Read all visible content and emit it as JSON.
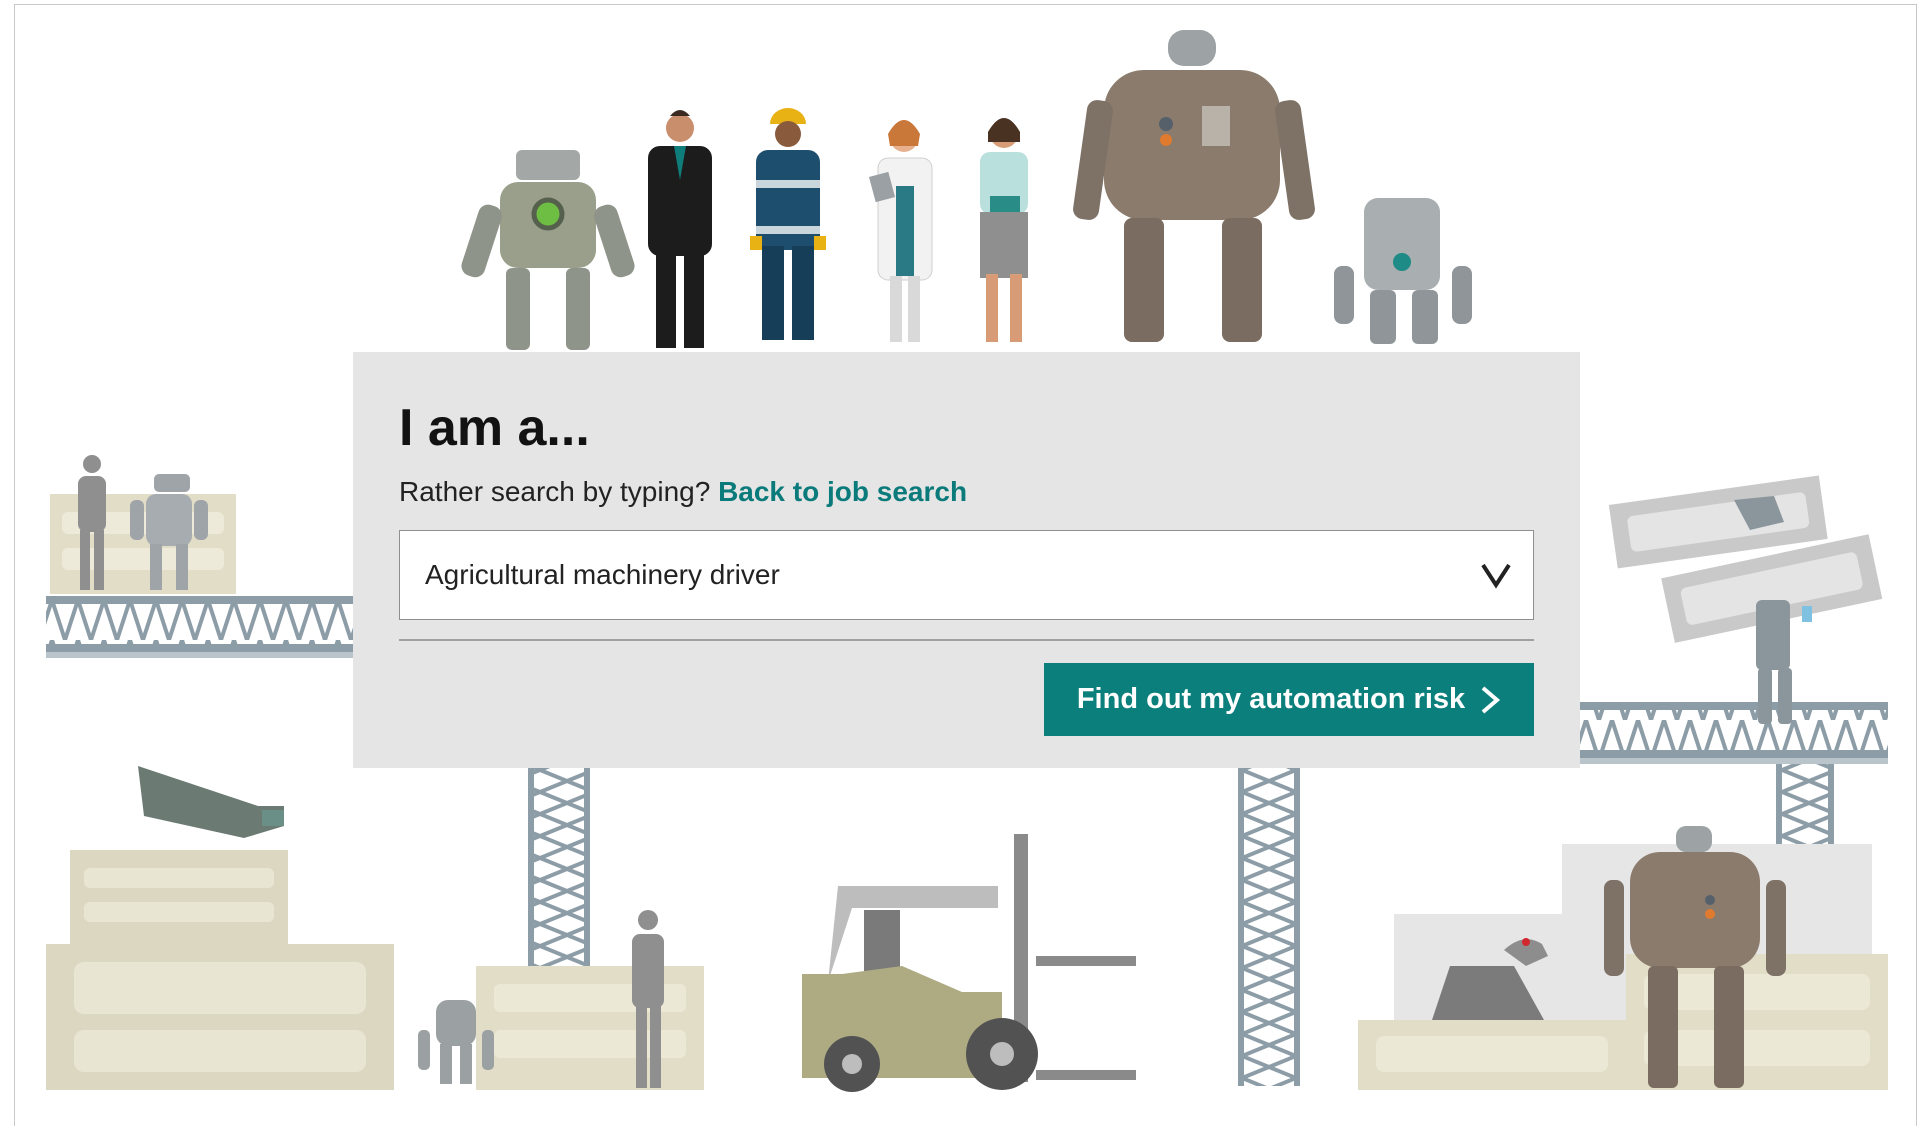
{
  "heading": "I am a...",
  "prompt": {
    "text": "Rather search by typing?",
    "link_label": "Back to job search"
  },
  "occupation_select": {
    "value": "Agricultural machinery driver"
  },
  "cta": {
    "label": "Find out my automation risk"
  },
  "colors": {
    "accent": "#0b7f7c",
    "link": "#0b7a7a",
    "panel": "#e5e5e5",
    "truss": "#8d9da7",
    "crate": "#dcd7c0"
  },
  "icons": {
    "select_chevron": "chevron-down-icon",
    "cta_arrow": "chevron-right-icon"
  }
}
